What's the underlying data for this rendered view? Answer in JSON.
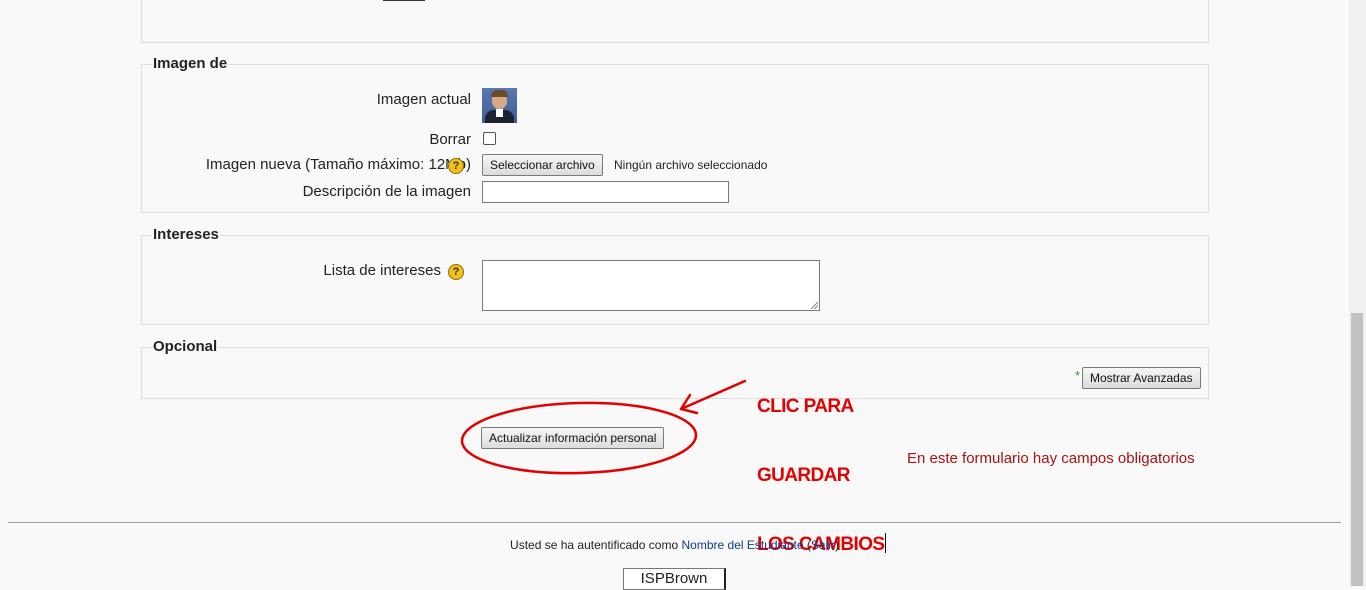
{
  "sections": {
    "image": {
      "legend": "Imagen de",
      "current_image_label": "Imagen actual",
      "delete_label": "Borrar",
      "new_image_label": "Imagen nueva (Tamaño máximo: 12Mb)",
      "select_file_button": "Seleccionar archivo",
      "no_file_text": "Ningún archivo seleccionado",
      "description_label": "Descripción de la imagen",
      "description_value": "",
      "delete_checked": false
    },
    "interests": {
      "legend": "Intereses",
      "list_label": "Lista de intereses",
      "list_value": ""
    },
    "optional": {
      "legend": "Opcional",
      "required_star": "*",
      "show_advanced_button": "Mostrar Avanzadas"
    }
  },
  "help_icon_glyph": "?",
  "submit_button": "Actualizar información personal",
  "annotation": {
    "lines": [
      "CLIC PARA",
      "GUARDAR",
      "LOS CAMBIOS"
    ],
    "color": "#e30000"
  },
  "required_note": "En este formulario hay campos obligatorios",
  "footer": {
    "login_prefix": "Usted se ha autentificado como",
    "user_name": "Nombre del Estudiante",
    "logout_open": "(",
    "logout_link": "Salir",
    "logout_close": ")",
    "home_button": "ISPBrown"
  },
  "colors": {
    "page_bg": "#f9f9f9",
    "link": "#0b3c8c",
    "required_note": "#aa1111",
    "required_star": "#2a9a2a"
  }
}
